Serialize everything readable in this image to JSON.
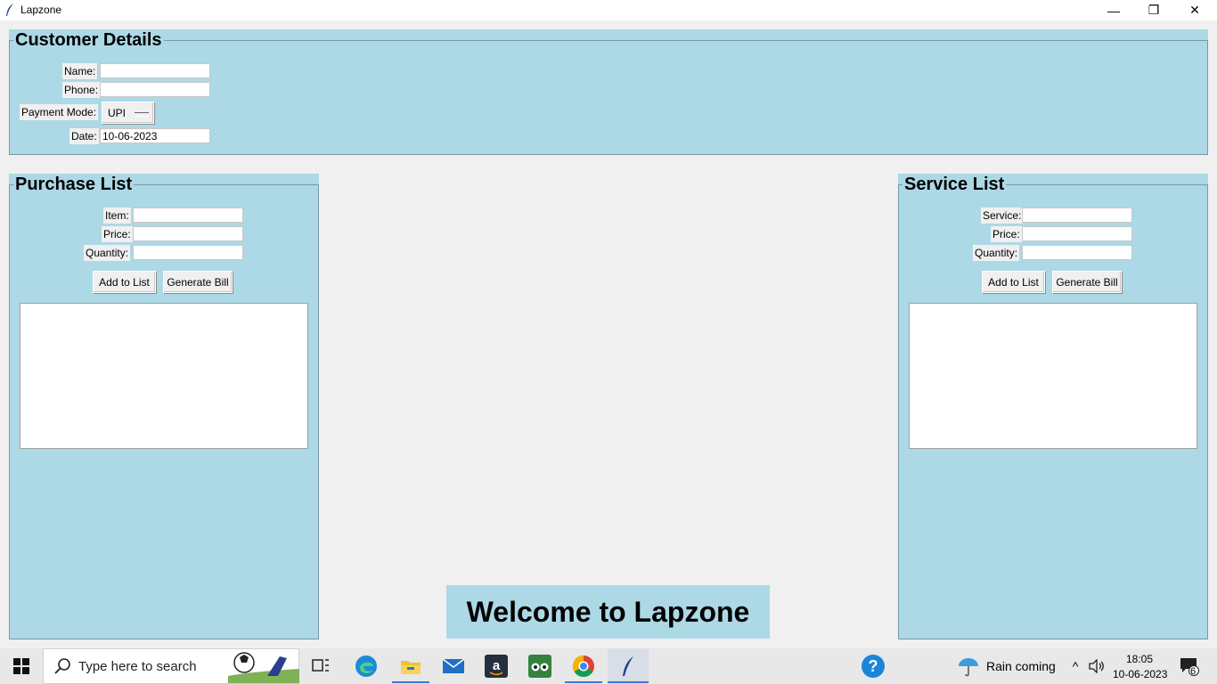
{
  "window": {
    "title": "Lapzone",
    "minimize_glyph": "—",
    "restore_glyph": "❐",
    "close_glyph": "✕"
  },
  "customer": {
    "heading": "Customer Details",
    "name_label": "Name:",
    "name_value": "",
    "phone_label": "Phone:",
    "phone_value": "",
    "payment_label": "Payment Mode:",
    "payment_value": "UPI",
    "date_label": "Date:",
    "date_value": "10-06-2023"
  },
  "purchase": {
    "heading": "Purchase List",
    "item_label": "Item:",
    "price_label": "Price:",
    "quantity_label": "Quantity:",
    "add_button": "Add to List",
    "bill_button": "Generate Bill"
  },
  "service": {
    "heading": "Service List",
    "service_label": "Service:",
    "price_label": "Price:",
    "quantity_label": "Quantity:",
    "add_button": "Add to List",
    "bill_button": "Generate Bill"
  },
  "welcome": "Welcome to Lapzone",
  "taskbar": {
    "search_placeholder": "Type here to search",
    "weather": "Rain coming",
    "time": "18:05",
    "date": "10-06-2023",
    "notifications": "6",
    "icons": [
      "windows-start-icon",
      "search-icon",
      "task-view-icon",
      "edge-icon",
      "file-explorer-icon",
      "mail-icon",
      "amazon-icon",
      "tripadvisor-icon",
      "chrome-icon",
      "python-feather-icon",
      "help-icon",
      "weather-icon",
      "chevron-up-icon",
      "volume-icon",
      "notification-icon"
    ]
  }
}
